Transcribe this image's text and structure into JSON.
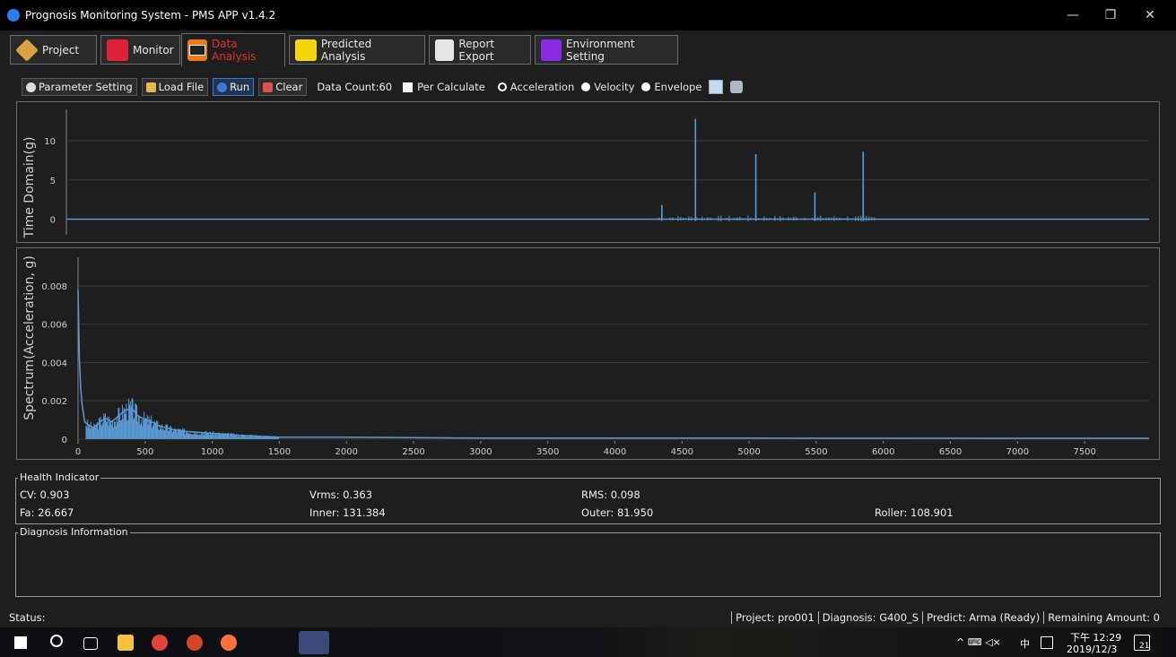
{
  "window": {
    "title": "Prognosis Monitoring System - PMS APP v1.4.2",
    "minimize": "—",
    "restore": "❐",
    "close": "✕"
  },
  "tabs": [
    {
      "label": "Project",
      "icon": "tag-icon"
    },
    {
      "label": "Monitor",
      "icon": "monitor-chart-icon"
    },
    {
      "label": "Data Analysis",
      "icon": "oscilloscope-icon"
    },
    {
      "label": "Predicted  Analysis",
      "icon": "bar-chart-icon"
    },
    {
      "label": "Report Export",
      "icon": "printer-icon"
    },
    {
      "label": "Environment Setting",
      "icon": "settings-icon"
    }
  ],
  "toolbar": {
    "parameter_setting": "Parameter Setting",
    "load_file": "Load File",
    "run": "Run",
    "clear": "Clear",
    "data_count": "Data Count:60",
    "per_calculate": "Per Calculate",
    "acceleration": "Acceleration",
    "velocity": "Velocity",
    "envelope": "Envelope"
  },
  "chart_data": [
    {
      "type": "line",
      "ylabel": "Time Domain(g)",
      "ylim": [
        -2,
        14
      ],
      "yticks": [
        0,
        5,
        10
      ],
      "color": "#5b9bd5",
      "spikes": [
        {
          "x": 4350,
          "y": 1.8
        },
        {
          "x": 4600,
          "y": 12.8
        },
        {
          "x": 5050,
          "y": 8.3
        },
        {
          "x": 5490,
          "y": 3.4
        },
        {
          "x": 5850,
          "y": 8.6
        }
      ]
    },
    {
      "type": "line",
      "ylabel": "Spectrum(Acceleration, g)",
      "xlim": [
        0,
        7980
      ],
      "ylim": [
        -0.0001,
        0.0095
      ],
      "xticks": [
        0,
        500,
        1000,
        1500,
        2000,
        2500,
        3000,
        3500,
        4000,
        4500,
        5000,
        5500,
        6000,
        6500,
        7000,
        7500
      ],
      "yticks": [
        0,
        0.002,
        0.004,
        0.006,
        0.008
      ],
      "ytick_labels": [
        "0",
        "0.002",
        "0.004",
        "0.006",
        "0.008"
      ],
      "color": "#5b9bd5",
      "x": [
        0,
        10,
        20,
        30,
        50,
        80,
        120,
        150,
        200,
        250,
        300,
        350,
        400,
        450,
        500,
        550,
        600,
        700,
        800,
        1000,
        1200,
        1500,
        2000,
        3000,
        5000,
        7980
      ],
      "y": [
        0.0078,
        0.0042,
        0.0026,
        0.0018,
        0.0009,
        0.0007,
        0.0006,
        0.0008,
        0.0011,
        0.0009,
        0.0012,
        0.0015,
        0.0016,
        0.0012,
        0.001,
        0.0009,
        0.0007,
        0.0005,
        0.0004,
        0.0003,
        0.0002,
        0.0001,
        0.0001,
        5e-05,
        5e-05,
        4e-05
      ]
    }
  ],
  "health": {
    "legend": "Health Indicator",
    "cv": "CV: 0.903",
    "vrms": "Vrms: 0.363",
    "rms": "RMS: 0.098",
    "fa": "Fa: 26.667",
    "inner": "Inner: 131.384",
    "outer": "Outer: 81.950",
    "roller": "Roller: 108.901"
  },
  "diagnosis": {
    "legend": "Diagnosis Information"
  },
  "status": {
    "label": "Status:",
    "project": "Project: pro001",
    "diagnosis": "Diagnosis: G400_S",
    "predict": "Predict: Arma (Ready)",
    "remaining": "Remaining Amount: 0"
  },
  "taskbar": {
    "time": "下午 12:29",
    "date": "2019/12/3",
    "ime": "中",
    "tray": "^ ⌨ ◁× ",
    "notif_count": "21"
  }
}
